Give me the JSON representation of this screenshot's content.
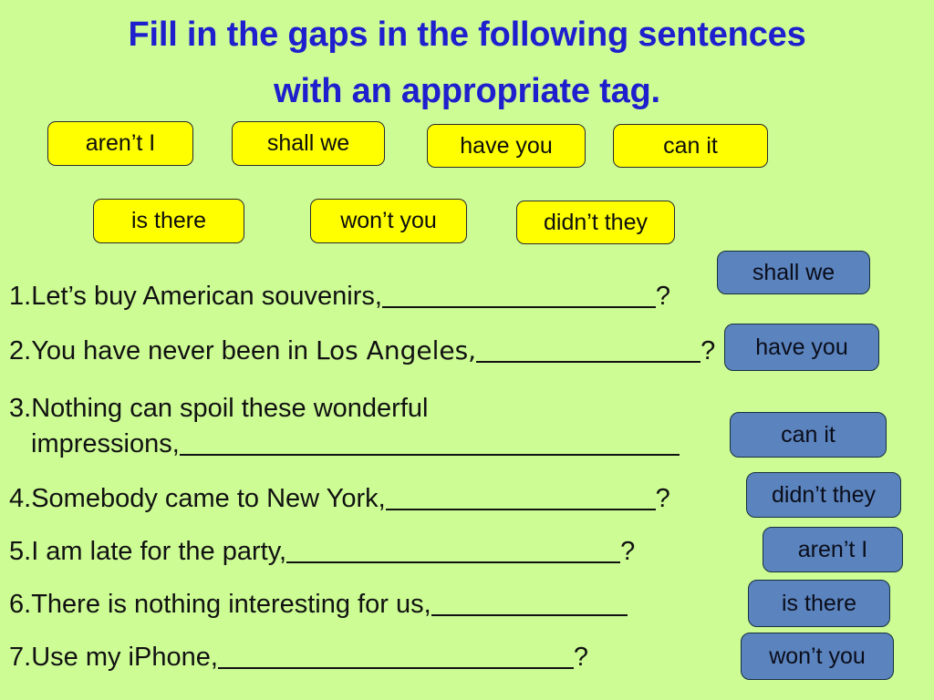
{
  "slide": {
    "background_color": "#cdfc95",
    "title_color": "#1f1fcd",
    "chip_yellow_color": "#ffff00",
    "chip_blue_color": "#5b83bd",
    "title": {
      "line1": "Fill in the gaps in the following sentences",
      "line2": "with an appropriate tag."
    },
    "word_bank": {
      "row1": [
        {
          "label": "aren’t I"
        },
        {
          "label": "shall we"
        },
        {
          "label": "have you"
        },
        {
          "label": "can it"
        }
      ],
      "row2": [
        {
          "label": "is there"
        },
        {
          "label": "won’t you"
        },
        {
          "label": "didn’t they"
        }
      ]
    },
    "sentences": [
      {
        "number": "1.",
        "text": "Let’s buy American souvenirs,",
        "question_mark": "?",
        "answer": "shall we"
      },
      {
        "number": "2.",
        "text_a": "You have never been in ",
        "text_b": "Los Angeles,",
        "question_mark": "?",
        "answer": "have you"
      },
      {
        "number": "3.",
        "text_line1": "Nothing can spoil these wonderful",
        "text_line2": "impressions,",
        "question_mark": "?",
        "answer": "can it"
      },
      {
        "number": "4.",
        "text": "Somebody came to New York,",
        "question_mark": "?",
        "answer": "didn’t they"
      },
      {
        "number": "5.",
        "text": "I am late for the party,",
        "question_mark": "?",
        "answer": "aren’t I"
      },
      {
        "number": "6.",
        "text": "There is nothing interesting for us,",
        "question_mark": "?",
        "answer": "is there"
      },
      {
        "number": "7.",
        "text": "Use my iPhone,",
        "question_mark": "?",
        "answer": "won’t you"
      }
    ]
  }
}
